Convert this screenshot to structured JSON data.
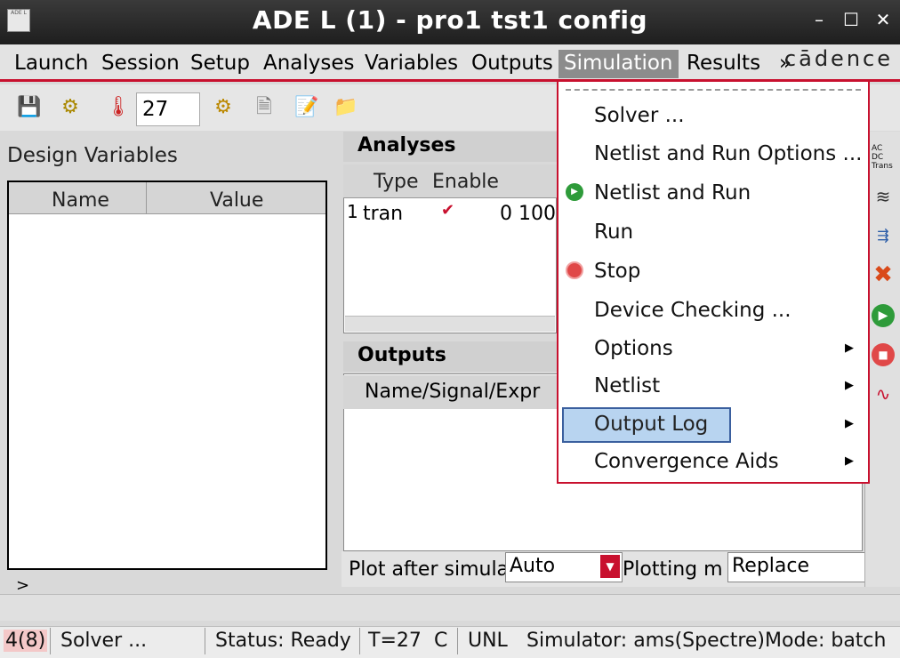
{
  "window": {
    "title": "ADE L (1) - pro1 tst1 config",
    "app_icon_text": "ADE L",
    "controls": [
      "–",
      "☐",
      "✕"
    ]
  },
  "menubar": {
    "items": [
      "Launch",
      "Session",
      "Setup",
      "Analyses",
      "Variables",
      "Outputs",
      "Simulation",
      "Results"
    ],
    "more": "»",
    "logo": "cādence"
  },
  "toolbar": {
    "temperature": "27",
    "temp_unit": "°C"
  },
  "design_variables": {
    "label": "Design Variables",
    "columns": [
      "Name",
      "Value"
    ]
  },
  "analyses": {
    "header": "Analyses",
    "columns": [
      "Type",
      "Enable"
    ],
    "rows": [
      {
        "index": "1",
        "type": "tran",
        "enabled": "✔",
        "args": "0 100"
      }
    ]
  },
  "outputs": {
    "header": "Outputs",
    "columns": [
      "Name/Signal/Expr"
    ]
  },
  "plot_controls": {
    "plot_after_label": "Plot after simula",
    "plot_after_value": "Auto",
    "plotting_mode_label": "Plotting m",
    "plotting_mode_value": "Replace"
  },
  "simulation_menu": {
    "items": [
      {
        "label": "Solver ...",
        "icon": "",
        "submenu": false
      },
      {
        "label": "Netlist and Run Options ...",
        "icon": "",
        "submenu": false
      },
      {
        "label": "Netlist and Run",
        "icon": "run-icon",
        "submenu": false
      },
      {
        "label": "Run",
        "icon": "",
        "submenu": false
      },
      {
        "label": "Stop",
        "icon": "stop-icon",
        "submenu": false
      },
      {
        "label": "Device Checking ...",
        "icon": "",
        "submenu": false
      },
      {
        "label": "Options",
        "icon": "",
        "submenu": true
      },
      {
        "label": "Netlist",
        "icon": "",
        "submenu": true
      },
      {
        "label": "Output Log",
        "icon": "",
        "submenu": true
      },
      {
        "label": "Convergence Aids",
        "icon": "",
        "submenu": true
      }
    ],
    "highlighted": "Output Log"
  },
  "right_strip": {
    "ac": "AC",
    "dc": "DC",
    "trans": "Trans"
  },
  "command_prompt": ">",
  "status_bar": {
    "count": "4(8)",
    "message": "Solver ...",
    "status": "Status: Ready",
    "temp": "T=27",
    "temp_unit": "C",
    "mode1": "UNL",
    "simulator": "Simulator: ams(Spectre)Mode: batch"
  },
  "colors": {
    "accent_red": "#c8102e",
    "highlight": "#b8d4f0",
    "run_green": "#2e9b3a",
    "stop_red": "#e04848"
  }
}
